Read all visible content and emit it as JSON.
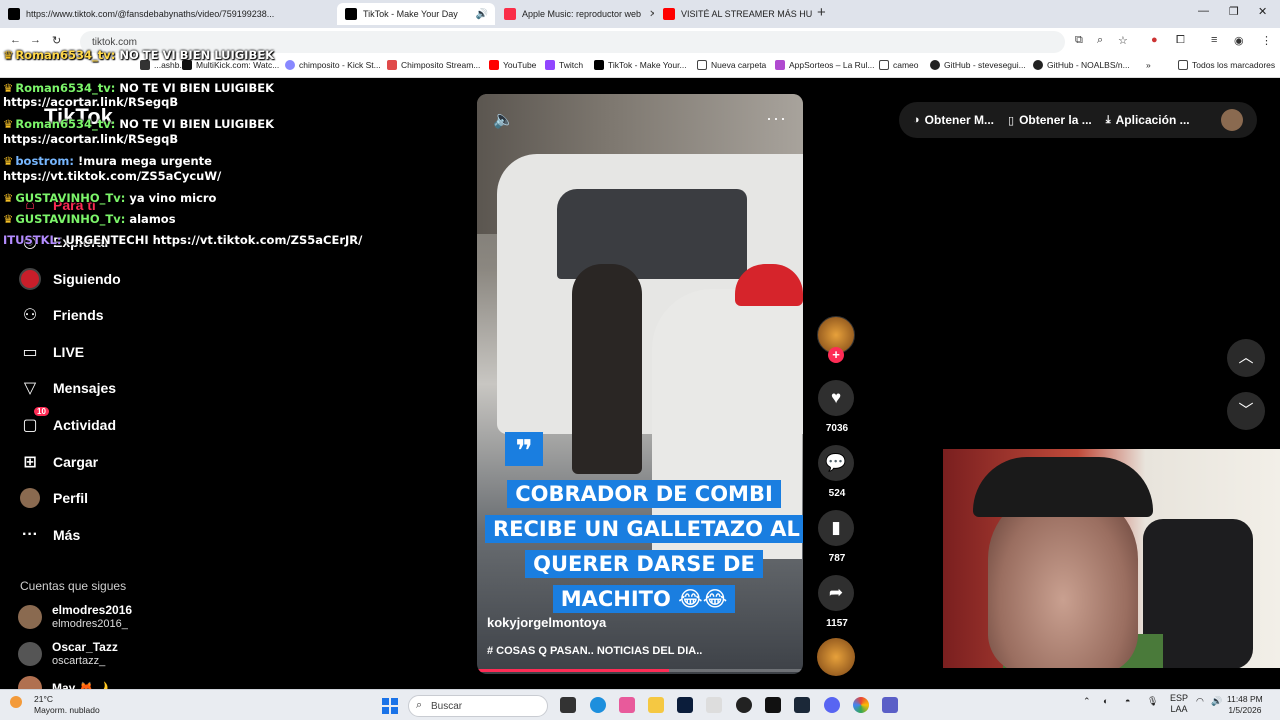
{
  "browser": {
    "tabs": [
      {
        "label": "https://www.tiktok.com/@fansdebabynaths/video/759199238...",
        "color": "#000000"
      },
      {
        "label": "TikTok - Make Your Day",
        "color": "#000000"
      },
      {
        "label": "Apple Music: reproductor web",
        "color": "#fa2d48"
      },
      {
        "label": "VISITÉ AL STREAMER MÁS HU...",
        "color": "#ff0000"
      }
    ],
    "address": "tiktok.com",
    "bookmarks": [
      "...ashb...",
      "MultiKick.com: Watc...",
      "chimposito - Kick St...",
      "Chimposito Stream...",
      "YouTube",
      "Twitch",
      "TikTok - Make Your...",
      "Nueva carpeta",
      "AppSorteos – La Rul...",
      "cameo",
      "GitHub - stevesegui...",
      "GitHub - NOALBS/n...",
      "Todos los marcadores"
    ]
  },
  "chat": [
    {
      "user": "Roman6534_tv:",
      "user_color": "user-y",
      "msg": "NO TE VI BIEN LUIGIBEK"
    },
    {
      "user": "",
      "user_color": "user-y",
      "msg": "https://acortar.link/RSegqB"
    },
    {
      "user": "Roman6534_tv:",
      "user_color": "user-g",
      "msg": "NO TE VI BIEN LUIGIBEK"
    },
    {
      "user": "",
      "user_color": "user-g",
      "msg": "https://acortar.link/RSegqB"
    },
    {
      "user": "Roman6534_tv:",
      "user_color": "user-g",
      "msg": "NO TE VI BIEN LUIGIBEK"
    },
    {
      "user": "",
      "user_color": "user-g",
      "msg": "https://acortar.link/RSegqB"
    },
    {
      "user": "bostrom:",
      "user_color": "user-b",
      "msg": "!mura mega urgente"
    },
    {
      "user": "",
      "user_color": "user-b",
      "msg": "https://vt.tiktok.com/ZS5aCycuW/"
    },
    {
      "user": "GUSTAVINHO_Tv:",
      "user_color": "user-g",
      "msg": "ya vino micro"
    },
    {
      "user": "GUSTAVINHO_Tv:",
      "user_color": "user-g",
      "msg": "alamos"
    },
    {
      "user": "ITUSTKL:",
      "user_color": "user-p",
      "msg": "URGENTECHI https://vt.tiktok.com/ZS5aCErJR/"
    }
  ],
  "sidebar": {
    "logo": "TikTok",
    "items": [
      {
        "label": "Para ti",
        "icon": "home-icon"
      },
      {
        "label": "Explorar",
        "icon": "compass-icon"
      },
      {
        "label": "Siguiendo",
        "icon": "following-icon"
      },
      {
        "label": "Friends",
        "icon": "friends-icon"
      },
      {
        "label": "LIVE",
        "icon": "live-icon"
      },
      {
        "label": "Mensajes",
        "icon": "send-icon"
      },
      {
        "label": "Actividad",
        "icon": "inbox-icon",
        "badge": "10"
      },
      {
        "label": "Cargar",
        "icon": "upload-icon"
      },
      {
        "label": "Perfil",
        "icon": "avatar-icon"
      },
      {
        "label": "Más",
        "icon": "more-icon"
      }
    ],
    "following_title": "Cuentas que sigues",
    "following": [
      {
        "name": "elmodres2016",
        "handle": "elmodres2016_"
      },
      {
        "name": "Oscar_Tazz",
        "handle": "oscartazz_"
      },
      {
        "name": "May 🦊🌙",
        "handle": ""
      }
    ]
  },
  "header": {
    "items": [
      "Obtener M...",
      "Obtener la ...",
      "Aplicación ..."
    ]
  },
  "video": {
    "caption": "COBRADOR DE COMBI RECIBE UN GALLETAZO AL QUERER DARSE DE MACHITO 😂😂",
    "author": "kokyjorgelmontoya",
    "description": "# COSAS Q PASAN.. NOTICIAS DEL DIA..",
    "progress": 0.59
  },
  "actions": {
    "likes": "7036",
    "comments": "524",
    "saves": "787",
    "shares": "1157"
  },
  "taskbar": {
    "weather_temp": "21°C",
    "weather_desc": "Mayorm. nublado",
    "search": "Buscar",
    "lang": "ESP",
    "lang2": "LAA",
    "time": "11:48 PM",
    "date": "1/5/2026"
  }
}
